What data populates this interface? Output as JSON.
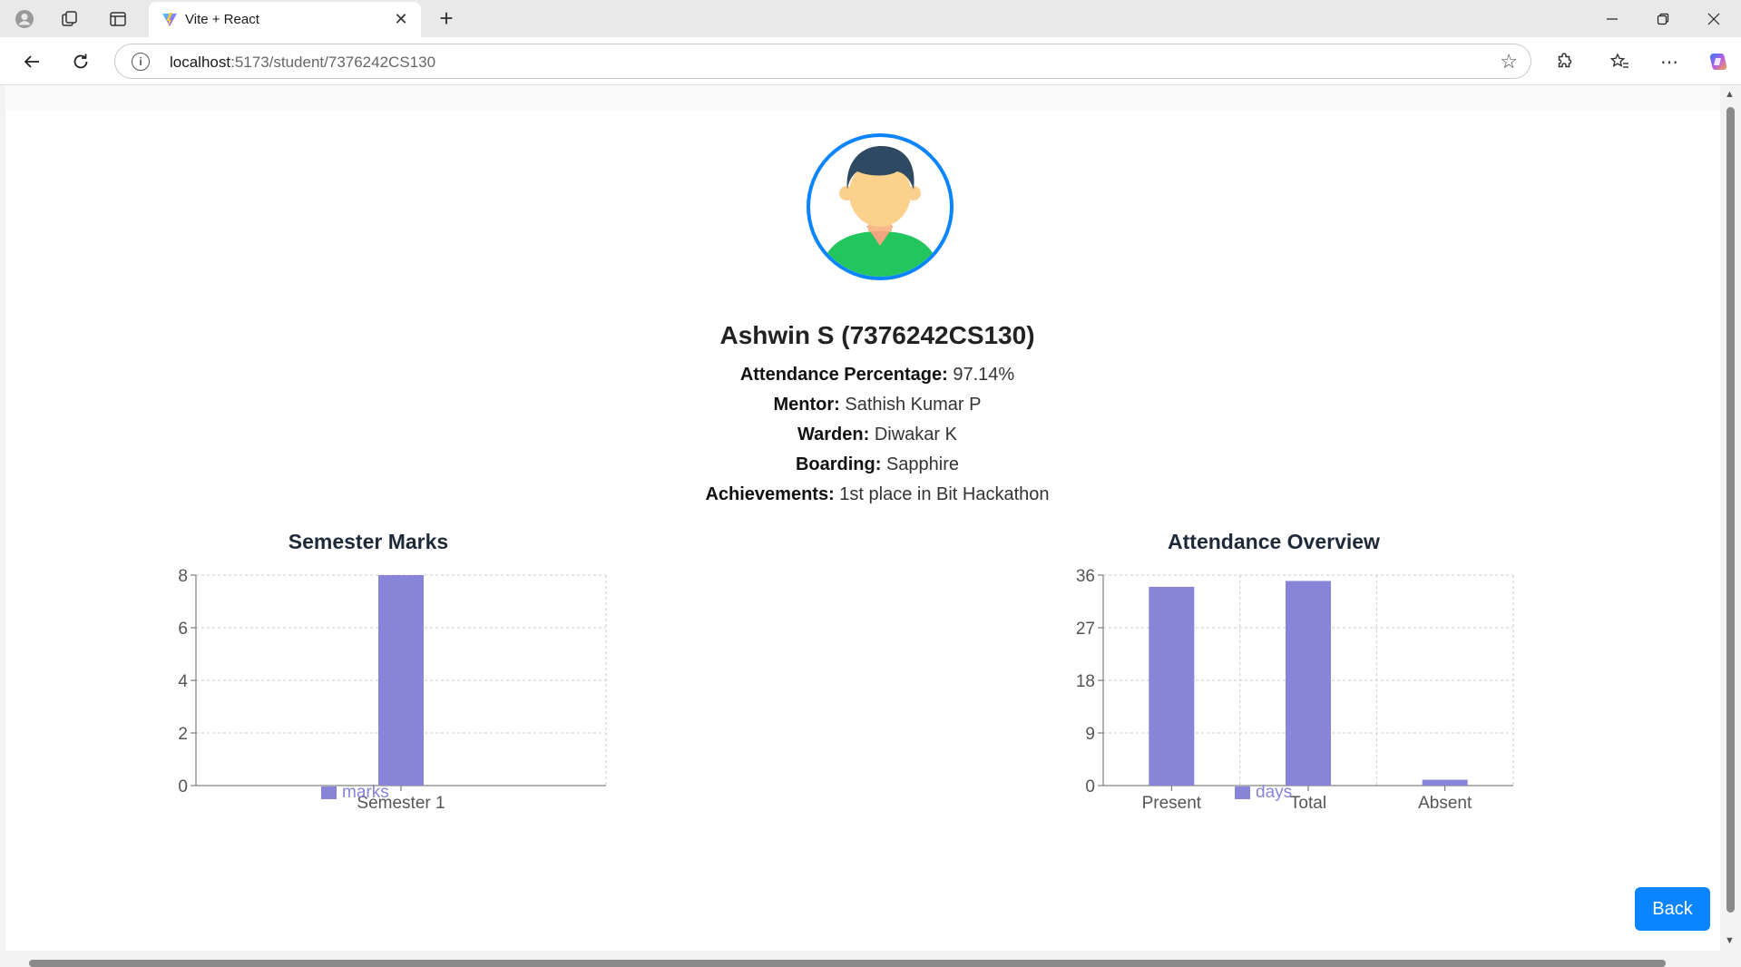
{
  "browser": {
    "tab_title": "Vite + React",
    "url_host": "localhost",
    "url_path": ":5173/student/7376242CS130"
  },
  "student": {
    "name_heading": "Ashwin S (7376242CS130)",
    "fields": [
      {
        "label": "Attendance Percentage:",
        "value": "97.14%"
      },
      {
        "label": "Mentor:",
        "value": "Sathish Kumar P"
      },
      {
        "label": "Warden:",
        "value": "Diwakar K"
      },
      {
        "label": "Boarding:",
        "value": "Sapphire"
      },
      {
        "label": "Achievements:",
        "value": "1st place in Bit Hackathon"
      }
    ]
  },
  "chart_data": [
    {
      "type": "bar",
      "title": "Semester Marks",
      "categories": [
        "Semester 1"
      ],
      "series": [
        {
          "name": "marks",
          "values": [
            8
          ]
        }
      ],
      "yticks": [
        0,
        2,
        4,
        6,
        8
      ],
      "ylim": [
        0,
        8
      ],
      "grid": true,
      "legend_position": "bottom",
      "color": "#8884d8"
    },
    {
      "type": "bar",
      "title": "Attendance Overview",
      "categories": [
        "Present",
        "Total",
        "Absent"
      ],
      "series": [
        {
          "name": "days",
          "values": [
            34,
            35,
            1
          ]
        }
      ],
      "yticks": [
        0,
        9,
        18,
        27,
        36
      ],
      "ylim": [
        0,
        36
      ],
      "grid": true,
      "legend_position": "bottom",
      "color": "#8884d8"
    }
  ],
  "back_button_label": "Back",
  "colors": {
    "accent": "#0b84ff",
    "bar": "#8884d8"
  }
}
